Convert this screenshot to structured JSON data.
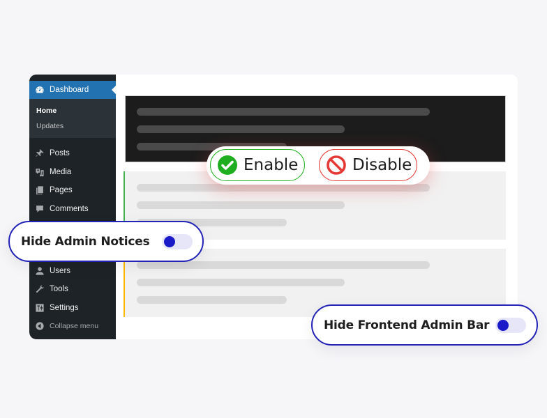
{
  "sidebar": {
    "dashboard": {
      "label": "Dashboard",
      "icon": "dashboard-icon"
    },
    "submenu": [
      {
        "label": "Home",
        "current": true
      },
      {
        "label": "Updates",
        "current": false
      }
    ],
    "items": [
      {
        "label": "Posts",
        "icon": "pin-icon"
      },
      {
        "label": "Media",
        "icon": "media-icon"
      },
      {
        "label": "Pages",
        "icon": "pages-icon"
      },
      {
        "label": "Comments",
        "icon": "comment-icon"
      },
      {
        "label": "Users",
        "icon": "user-icon"
      },
      {
        "label": "Tools",
        "icon": "wrench-icon"
      },
      {
        "label": "Settings",
        "icon": "settings-icon"
      }
    ],
    "collapse": {
      "label": "Collapse menu",
      "icon": "collapse-icon"
    }
  },
  "actions": {
    "enable_label": "Enable",
    "disable_label": "Disable"
  },
  "toggles": {
    "admin_notices": {
      "label": "Hide Admin Notices",
      "on": false
    },
    "frontend_admin_bar": {
      "label": "Hide Frontend Admin Bar",
      "on": false
    }
  },
  "colors": {
    "wp_blue": "#2271b1",
    "enable_green": "#22b022",
    "disable_red": "#e53935",
    "toggle_accent": "#1a1ac8",
    "notice_success": "#46b450",
    "notice_warning": "#ffb900"
  }
}
